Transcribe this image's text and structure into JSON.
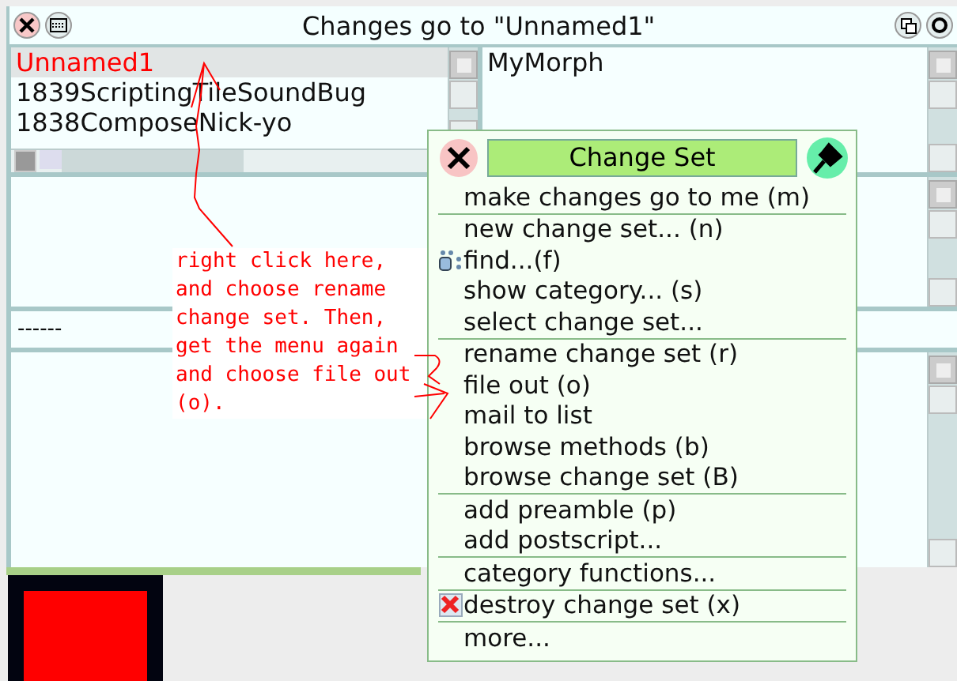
{
  "window": {
    "title": "Changes go to \"Unnamed1\""
  },
  "change_sets": [
    {
      "label": "Unnamed1",
      "selected": true
    },
    {
      "label": "1839ScriptingTileSoundBug",
      "selected": false
    },
    {
      "label": "1838ComposeNick-yo",
      "selected": false
    }
  ],
  "classes": [
    {
      "label": "MyMorph"
    }
  ],
  "code_separator": "------",
  "annotation": {
    "text": "right click here, and choose rename change set. Then, get the menu again and choose file out (o)."
  },
  "menu": {
    "title": "Change Set",
    "groups": [
      [
        {
          "label": "make changes go to me (m)",
          "kind": "plain"
        }
      ],
      [
        {
          "label": "new change set... (n)",
          "kind": "plain"
        },
        {
          "label": "find...(f)",
          "kind": "find"
        },
        {
          "label": "show category... (s)",
          "kind": "plain"
        },
        {
          "label": "select change set...",
          "kind": "plain"
        }
      ],
      [
        {
          "label": "rename change set (r)",
          "kind": "plain"
        },
        {
          "label": "file out (o)",
          "kind": "plain"
        },
        {
          "label": "mail to list",
          "kind": "plain"
        },
        {
          "label": "browse methods (b)",
          "kind": "plain"
        },
        {
          "label": "browse change set (B)",
          "kind": "plain"
        }
      ],
      [
        {
          "label": "add preamble (p)",
          "kind": "plain"
        },
        {
          "label": "add postscript...",
          "kind": "plain"
        }
      ],
      [
        {
          "label": "category functions...",
          "kind": "plain"
        }
      ],
      [
        {
          "label": "destroy change set (x)",
          "kind": "delete"
        }
      ],
      [
        {
          "label": "more...",
          "kind": "plain"
        }
      ]
    ]
  }
}
